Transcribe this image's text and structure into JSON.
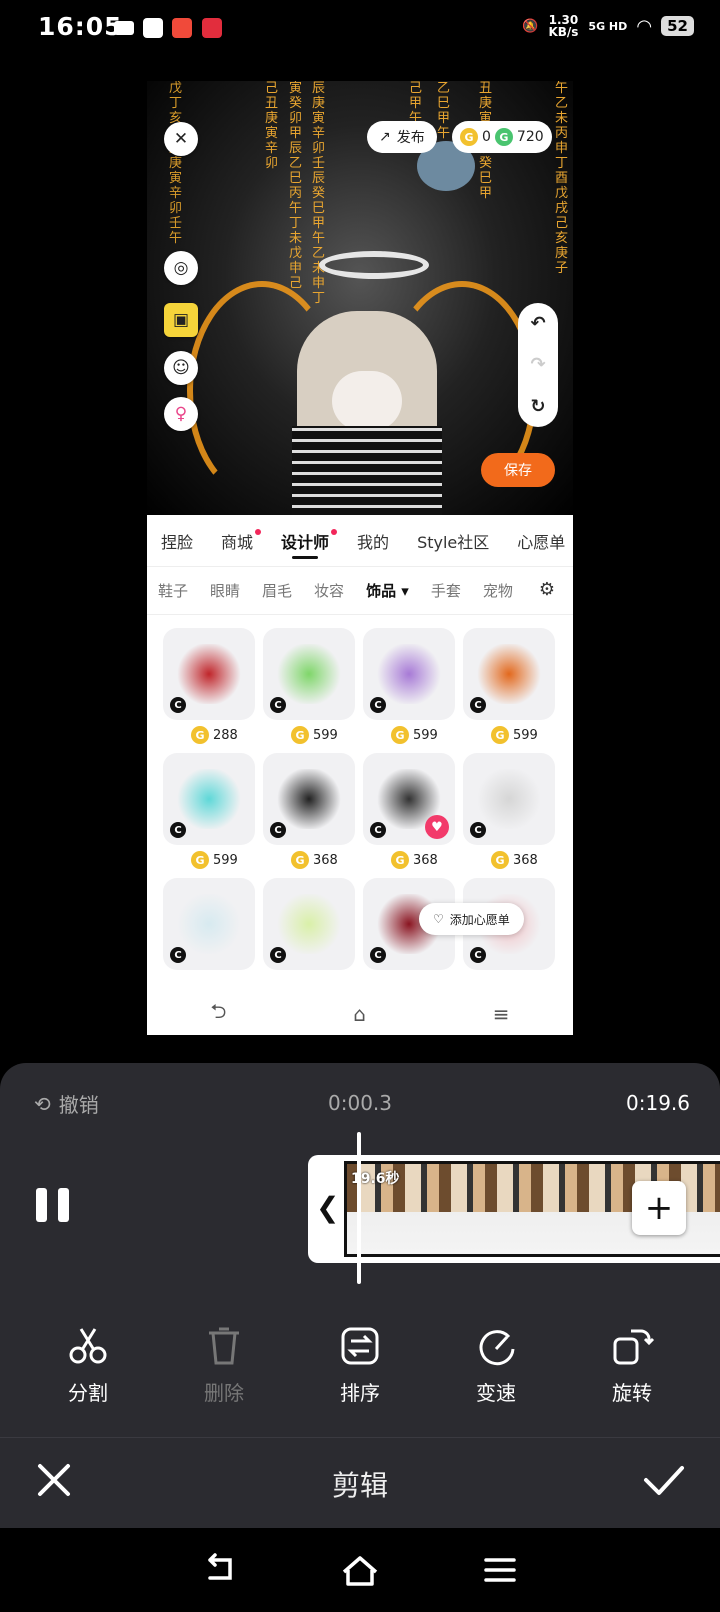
{
  "status_bar": {
    "time": "16:05",
    "net_speed": "1.30",
    "net_unit": "KB/s",
    "network": "5G HD",
    "battery": "52"
  },
  "preview": {
    "publish_label": "发布",
    "coins": "0",
    "gcoins": "720",
    "save_label": "保存",
    "column_text": [
      "戊丁亥己丑庚寅辛卯壬午",
      "己丑庚寅辛卯",
      "寅癸卯甲辰乙巳丙午丁未戊申己",
      "辰庚寅辛卯壬辰癸巳甲午乙未申丁",
      "己甲午",
      "乙巳甲午",
      "丑庚寅壬辰癸巳甲",
      "午乙未丙申丁酉戊戌己亥庚子"
    ],
    "tabs": [
      {
        "label": "捏脸",
        "dot": false
      },
      {
        "label": "商城",
        "dot": true
      },
      {
        "label": "设计师",
        "dot": true,
        "active": true
      },
      {
        "label": "我的",
        "dot": false
      },
      {
        "label": "Style社区",
        "dot": false
      },
      {
        "label": "心愿单",
        "dot": false
      }
    ],
    "subtabs": [
      "鞋子",
      "眼睛",
      "眉毛",
      "妆容",
      "饰品 ▾",
      "手套",
      "宠物"
    ],
    "items": [
      {
        "price": "288",
        "color": "#c0262b"
      },
      {
        "price": "599",
        "color": "#7fd66a"
      },
      {
        "price": "599",
        "color": "#a77ad6"
      },
      {
        "price": "599",
        "color": "#e2691e"
      },
      {
        "price": "599",
        "color": "#5fd8d8"
      },
      {
        "price": "368",
        "color": "#222222"
      },
      {
        "price": "368",
        "color": "#333333"
      },
      {
        "price": "368",
        "color": "#d6d6d6"
      },
      {
        "price": "",
        "color": "#d7eaf0"
      },
      {
        "price": "",
        "color": "#d9f0a8"
      },
      {
        "price": "",
        "color": "#8a1521"
      },
      {
        "price": "",
        "color": "#f1c2c6"
      }
    ],
    "wishlist_label": "添加心愿单"
  },
  "editor": {
    "undo_label": "撤销",
    "current_time": "0:00.3",
    "total_time": "0:19.6",
    "clip_duration": "19.6秒",
    "tools": [
      {
        "label": "分割",
        "icon": "scissors-icon",
        "enabled": true
      },
      {
        "label": "删除",
        "icon": "trash-icon",
        "enabled": false
      },
      {
        "label": "排序",
        "icon": "sort-icon",
        "enabled": true
      },
      {
        "label": "变速",
        "icon": "speed-icon",
        "enabled": true
      },
      {
        "label": "旋转",
        "icon": "rotate-icon",
        "enabled": true
      }
    ],
    "title": "剪辑"
  }
}
